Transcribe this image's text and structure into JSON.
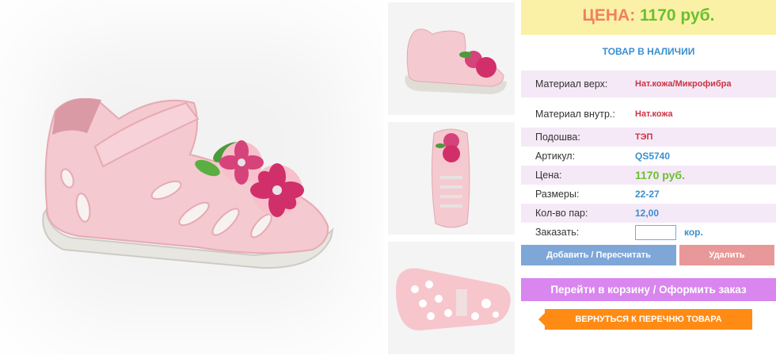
{
  "images": {
    "main_alt": "",
    "thumbs": [
      "thumb-side",
      "thumb-top",
      "thumb-sole"
    ]
  },
  "price_header": {
    "label": "ЦЕНА:",
    "value": "1170 руб."
  },
  "stock_status": "ТОВАР В НАЛИЧИИ",
  "specs": [
    {
      "key": "Материал верх:",
      "value": "Нат.кожа/Микрофибра"
    },
    {
      "key": "Материал внутр.:",
      "value": "Нат.кожа"
    },
    {
      "key": "Подошва:",
      "value": "ТЭП"
    },
    {
      "key": "Артикул:",
      "value": "QS5740"
    },
    {
      "key": "Цена:",
      "value": "1170 руб."
    },
    {
      "key": "Размеры:",
      "value": "22-27"
    },
    {
      "key": "Кол-во пар:",
      "value": "12,00"
    }
  ],
  "order": {
    "label": "Заказать:",
    "value": "",
    "unit": "кор."
  },
  "buttons": {
    "add": "Добавить / Пересчитать",
    "remove": "Удалить",
    "cart": "Перейти в корзину / Оформить заказ",
    "back": "ВЕРНУТЬСЯ К ПЕРЕЧНЮ ТОВАРА"
  },
  "colors": {
    "price_bg": "#fbf1a6",
    "price_label": "#f08060",
    "price_value": "#6ac030",
    "link_blue": "#3a8fd0",
    "spec_red": "#cc3344",
    "row_pink": "#f5e9f7",
    "add_button": "#7ea7d8",
    "remove_button": "#e89898",
    "cart_button": "#d986ef",
    "back_button": "#ff8b14"
  },
  "icons": {
    "back_arrow": "arrow-left-icon"
  }
}
